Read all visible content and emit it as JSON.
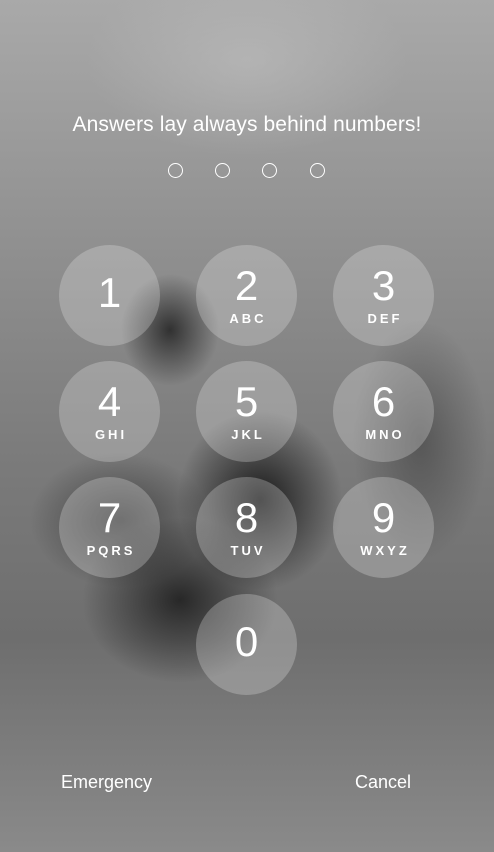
{
  "prompt": {
    "title": "Answers lay always behind numbers!"
  },
  "passcode": {
    "length": 4,
    "entered": 0
  },
  "keypad": {
    "keys": [
      {
        "digit": "1",
        "letters": ""
      },
      {
        "digit": "2",
        "letters": "ABC"
      },
      {
        "digit": "3",
        "letters": "DEF"
      },
      {
        "digit": "4",
        "letters": "GHI"
      },
      {
        "digit": "5",
        "letters": "JKL"
      },
      {
        "digit": "6",
        "letters": "MNO"
      },
      {
        "digit": "7",
        "letters": "PQRS"
      },
      {
        "digit": "8",
        "letters": "TUV"
      },
      {
        "digit": "9",
        "letters": "WXYZ"
      },
      {
        "digit": "0",
        "letters": ""
      }
    ]
  },
  "footer": {
    "emergency_label": "Emergency",
    "cancel_label": "Cancel"
  },
  "colors": {
    "text": "#ffffff",
    "key_fill": "rgba(235,235,235,0.28)"
  }
}
